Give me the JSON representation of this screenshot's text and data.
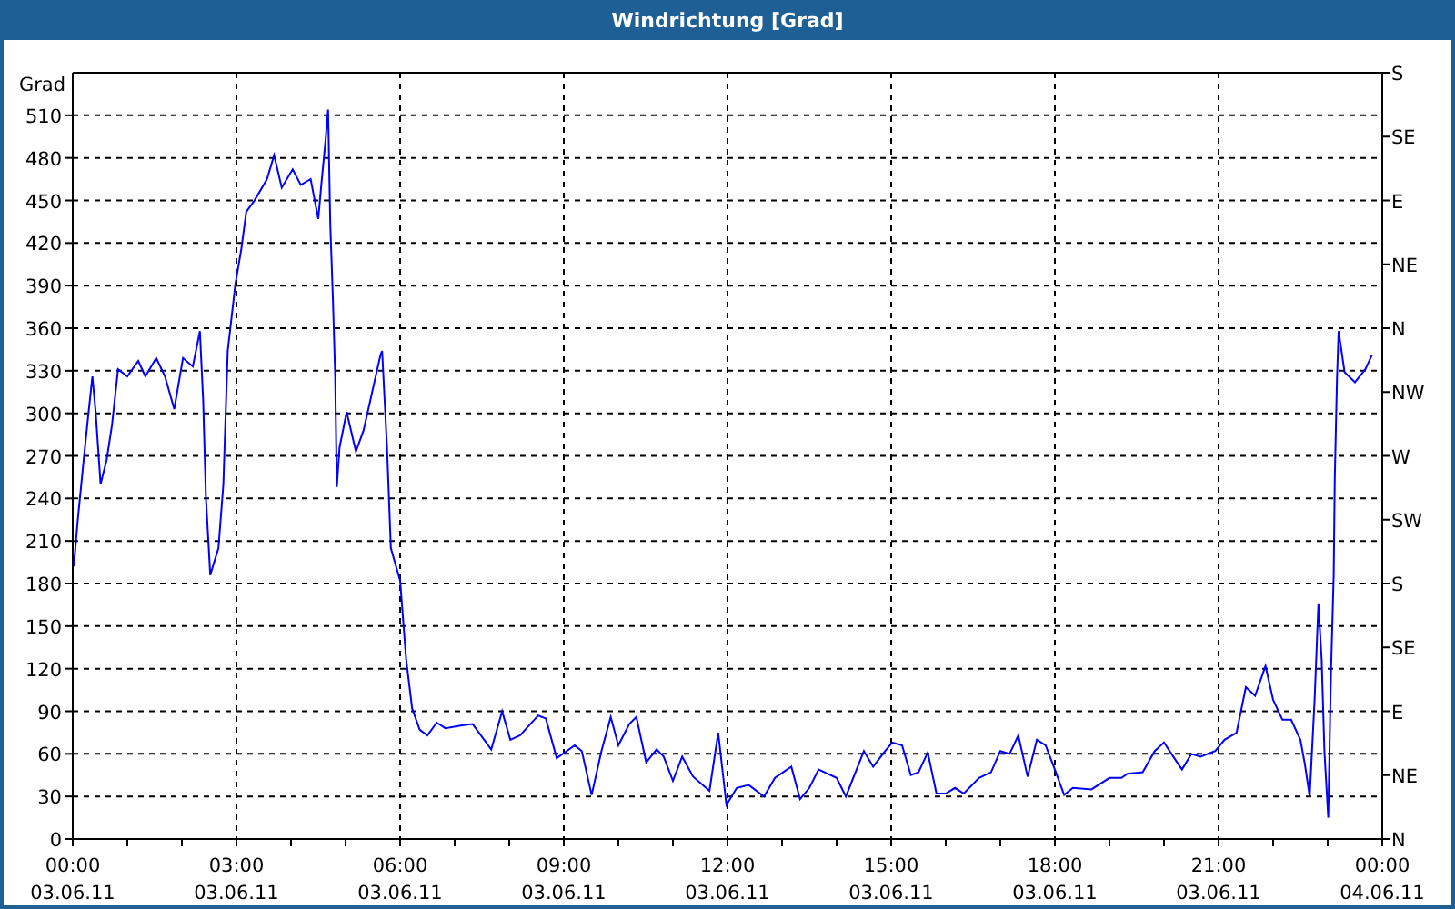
{
  "window": {
    "title": "Windrichtung [Grad]"
  },
  "compass_axis": {
    "labels": [
      "S",
      "SE",
      "E",
      "NE",
      "N",
      "NW",
      "W",
      "SW",
      "S",
      "SE",
      "E",
      "NE",
      "N"
    ]
  },
  "date_row": {
    "labels": [
      "03.06.11",
      "03.06.11",
      "03.06.11",
      "03.06.11",
      "03.06.11",
      "03.06.11",
      "03.06.11",
      "03.06.11",
      "04.06.11"
    ]
  },
  "chart_data": {
    "type": "line",
    "ylabel": "Grad",
    "grid": true,
    "xlim": [
      0,
      24
    ],
    "ylim": [
      0,
      540
    ],
    "xticks": [
      {
        "value": 0,
        "label": "00:00"
      },
      {
        "value": 3,
        "label": "03:00"
      },
      {
        "value": 6,
        "label": "06:00"
      },
      {
        "value": 9,
        "label": "09:00"
      },
      {
        "value": 12,
        "label": "12:00"
      },
      {
        "value": 15,
        "label": "15:00"
      },
      {
        "value": 18,
        "label": "18:00"
      },
      {
        "value": 21,
        "label": "21:00"
      },
      {
        "value": 24,
        "label": "00:00"
      }
    ],
    "yticks": [
      0,
      30,
      60,
      90,
      120,
      150,
      180,
      210,
      240,
      270,
      300,
      330,
      360,
      390,
      420,
      450,
      480,
      510
    ],
    "x": [
      0.02,
      0.09,
      0.2,
      0.28,
      0.36,
      0.42,
      0.51,
      0.62,
      0.72,
      0.83,
      1.0,
      1.2,
      1.33,
      1.53,
      1.69,
      1.86,
      2.02,
      2.2,
      2.33,
      2.39,
      2.44,
      2.52,
      2.67,
      2.76,
      2.84,
      2.98,
      3.09,
      3.18,
      3.33,
      3.56,
      3.69,
      3.83,
      4.03,
      4.18,
      4.36,
      4.5,
      4.56,
      4.63,
      4.68,
      4.72,
      4.77,
      4.81,
      4.84,
      4.89,
      5.02,
      5.19,
      5.33,
      5.64,
      5.67,
      5.76,
      5.83,
      6.0,
      6.11,
      6.22,
      6.36,
      6.5,
      6.67,
      6.83,
      7.11,
      7.33,
      7.67,
      7.87,
      8.02,
      8.2,
      8.53,
      8.67,
      8.87,
      9.2,
      9.33,
      9.51,
      9.69,
      9.86,
      10.0,
      10.2,
      10.33,
      10.51,
      10.7,
      10.83,
      11.0,
      11.17,
      11.37,
      11.67,
      11.83,
      11.98,
      12.17,
      12.39,
      12.67,
      12.87,
      13.17,
      13.33,
      13.5,
      13.67,
      14.0,
      14.17,
      14.5,
      14.67,
      14.89,
      15.02,
      15.2,
      15.36,
      15.5,
      15.67,
      15.83,
      16.0,
      16.17,
      16.33,
      16.61,
      16.83,
      17.0,
      17.17,
      17.33,
      17.5,
      17.67,
      17.83,
      18.0,
      18.17,
      18.33,
      18.67,
      19.0,
      19.22,
      19.33,
      19.61,
      19.83,
      20.0,
      20.17,
      20.33,
      20.5,
      20.67,
      20.94,
      21.11,
      21.33,
      21.5,
      21.67,
      21.86,
      22.0,
      22.17,
      22.33,
      22.5,
      22.58,
      22.67,
      22.76,
      22.83,
      22.89,
      22.94,
      23.01,
      23.06,
      23.11,
      23.13,
      23.17,
      23.2,
      23.31,
      23.5,
      23.69,
      23.81
    ],
    "series": [
      {
        "color": "#0000ff",
        "values": [
          192,
          224,
          267,
          297,
          326,
          301,
          250,
          267,
          292,
          331,
          326,
          337,
          326,
          339,
          326,
          303,
          339,
          333,
          358,
          309,
          241,
          186,
          205,
          250,
          344,
          391,
          416,
          442,
          450,
          465,
          482,
          459,
          472,
          461,
          465,
          437,
          463,
          491,
          514,
          433,
          378,
          326,
          248,
          276,
          301,
          273,
          288,
          341,
          344,
          276,
          205,
          182,
          127,
          92,
          77,
          73,
          82,
          78,
          80,
          81,
          63,
          90,
          70,
          73,
          87,
          85,
          57,
          66,
          62,
          31,
          62,
          86,
          66,
          81,
          86,
          54,
          63,
          58,
          41,
          58,
          44,
          34,
          75,
          24,
          36,
          38,
          30,
          43,
          51,
          28,
          36,
          49,
          43,
          30,
          62,
          51,
          62,
          68,
          66,
          45,
          47,
          61,
          32,
          32,
          36,
          32,
          43,
          47,
          62,
          60,
          73,
          44,
          70,
          66,
          49,
          31,
          36,
          35,
          43,
          43,
          46,
          47,
          62,
          68,
          58,
          49,
          60,
          58,
          62,
          70,
          75,
          107,
          101,
          122,
          98,
          84,
          84,
          70,
          53,
          30,
          98,
          166,
          126,
          62,
          15,
          117,
          186,
          254,
          324,
          358,
          329,
          322,
          331,
          341
        ]
      }
    ]
  }
}
